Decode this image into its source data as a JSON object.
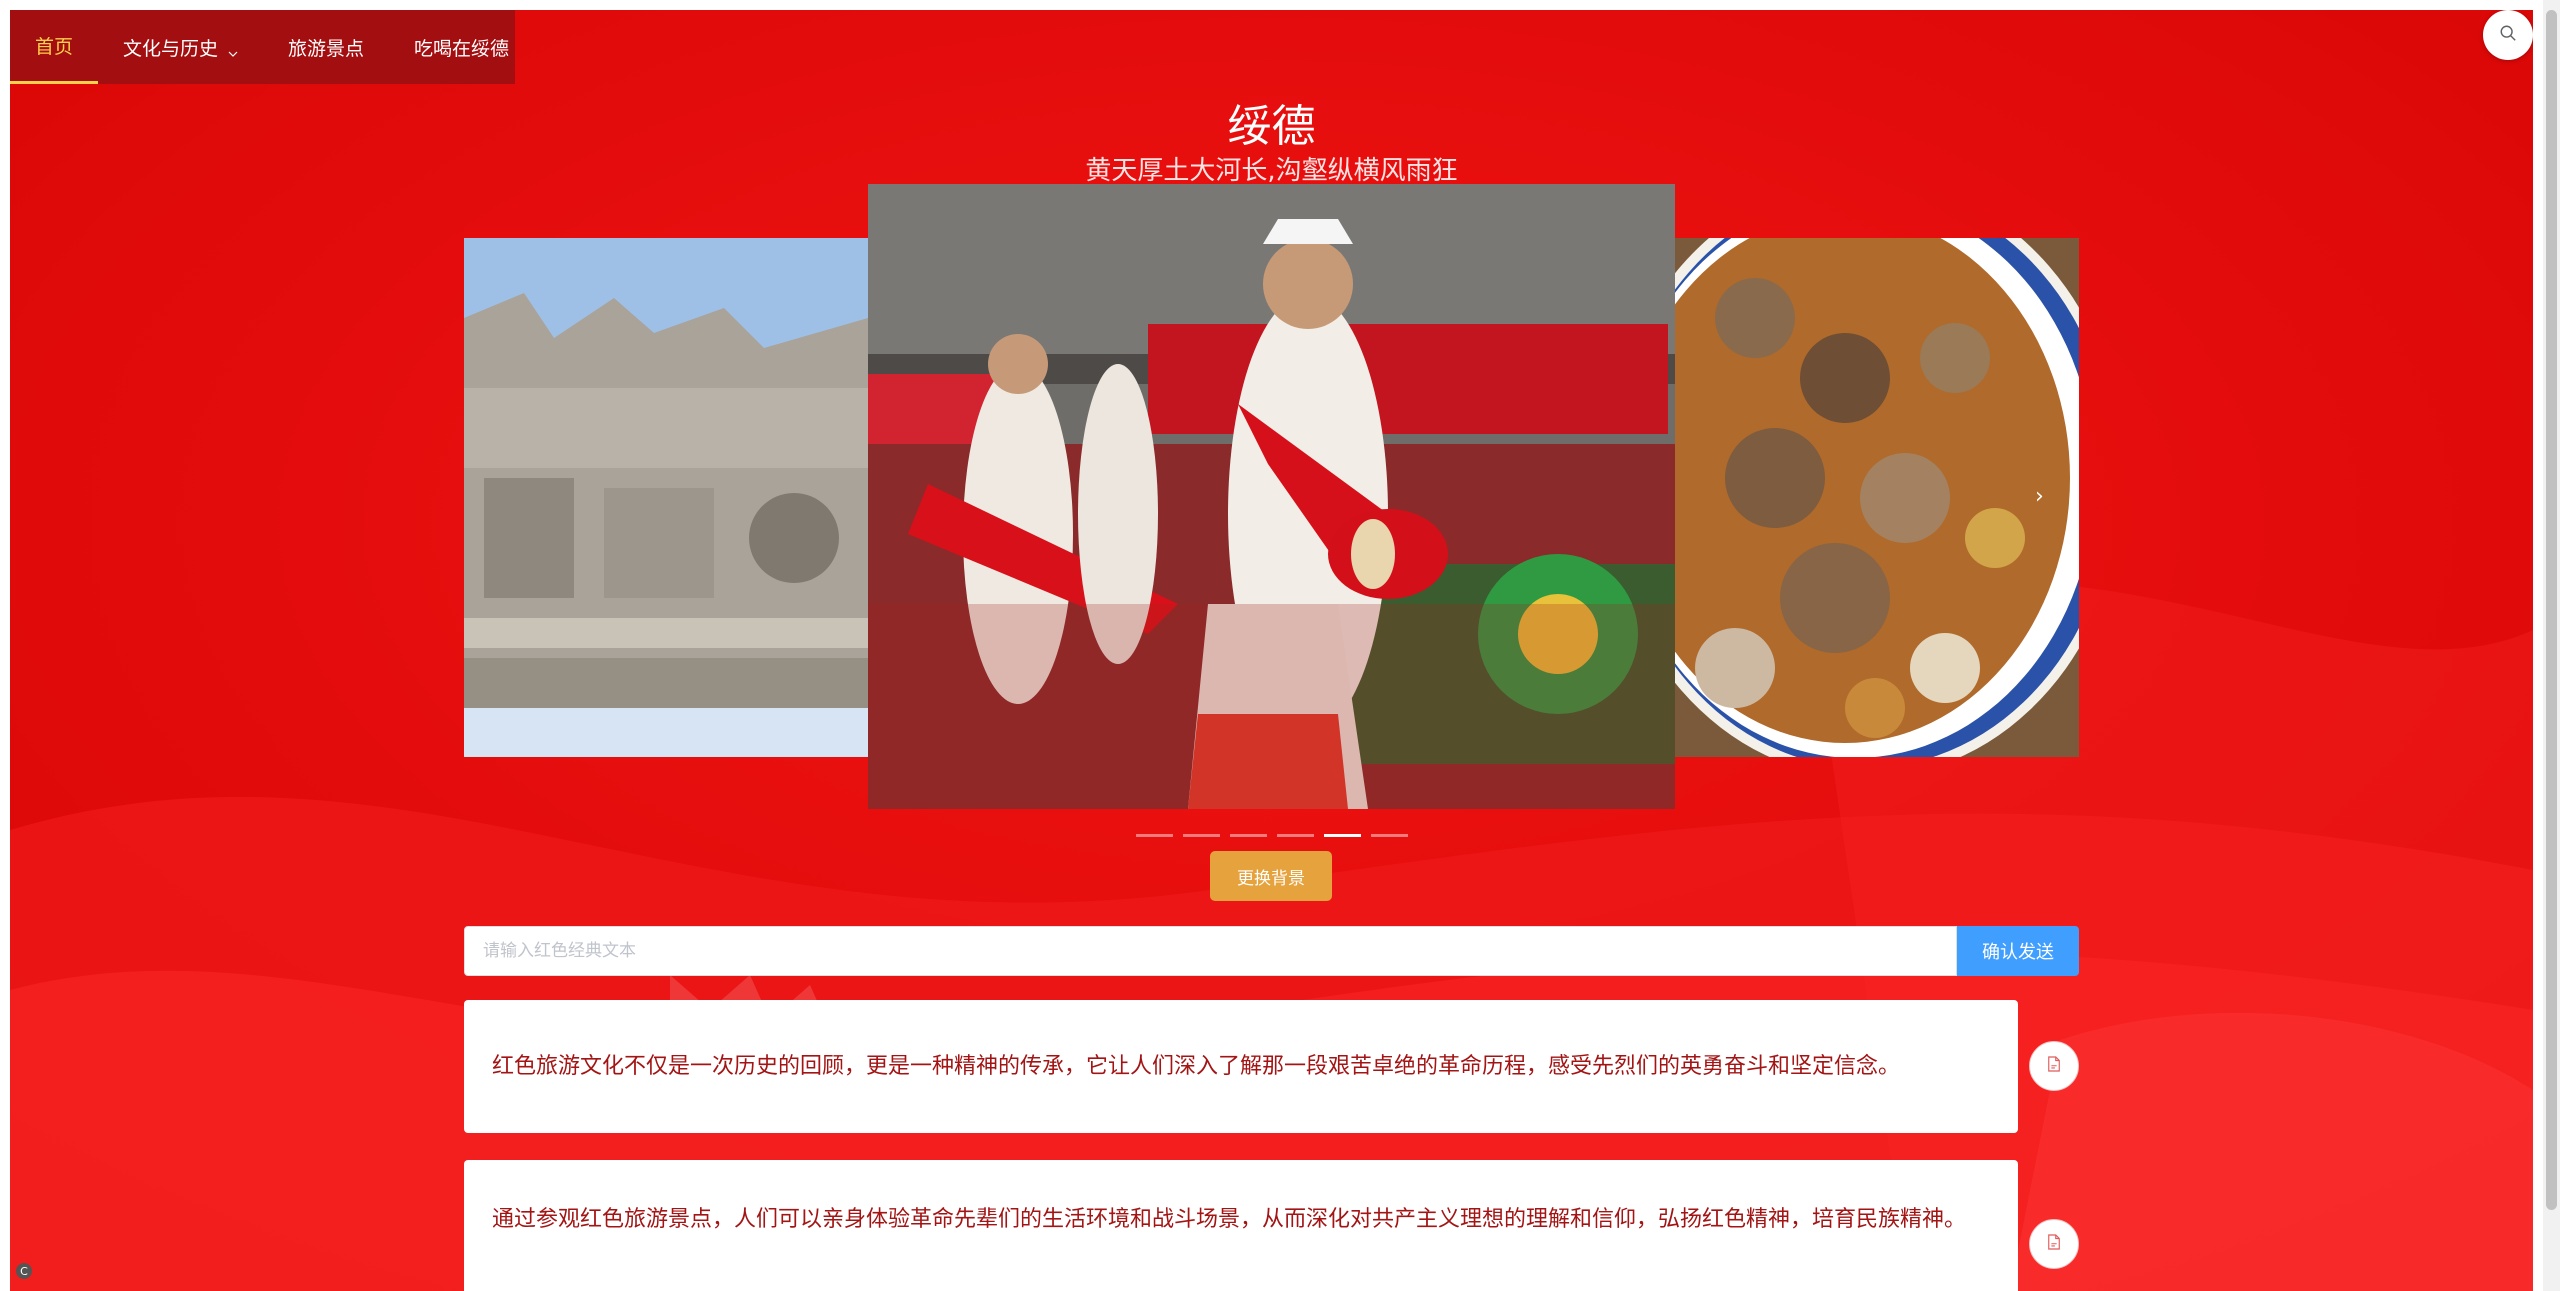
{
  "nav": {
    "items": [
      {
        "label": "首页",
        "active": true
      },
      {
        "label": "文化与历史",
        "has_dropdown": true
      },
      {
        "label": "旅游景点"
      },
      {
        "label": "吃喝在绥德"
      }
    ]
  },
  "hero": {
    "title": "绥德",
    "subtitle": "黄天厚土大河长,沟壑纵横风雨狂"
  },
  "carousel": {
    "slides": [
      {
        "icon": "stone-archway-photo"
      },
      {
        "icon": "waist-drum-dancer-photo"
      },
      {
        "icon": "stewed-mutton-bowl-photo"
      }
    ],
    "indicator_count": 6,
    "active_indicator": 4
  },
  "actions": {
    "change_background_label": "更换背景"
  },
  "input": {
    "placeholder": "请输入红色经典文本",
    "value": "",
    "send_label": "确认发送"
  },
  "cards": [
    {
      "text": "红色旅游文化不仅是一次历史的回顾，更是一种精神的传承，它让人们深入了解那一段艰苦卓绝的革命历程，感受先烈们的英勇奋斗和坚定信念。"
    },
    {
      "text": "通过参观红色旅游景点，人们可以亲身体验革命先辈们的生活环境和战斗场景，从而深化对共产主义理想的理解和信仰，弘扬红色精神，培育民族精神。"
    }
  ],
  "colors": {
    "background": "#e60b0b",
    "nav_bg": "#a30e10",
    "nav_active": "#ffd04b",
    "primary": "#409eff",
    "warning": "#e6a23c",
    "card_text": "#a31515"
  },
  "icons": {
    "search": "search-icon",
    "document": "pdf-document-icon",
    "chevron": "chevron-down-icon"
  }
}
